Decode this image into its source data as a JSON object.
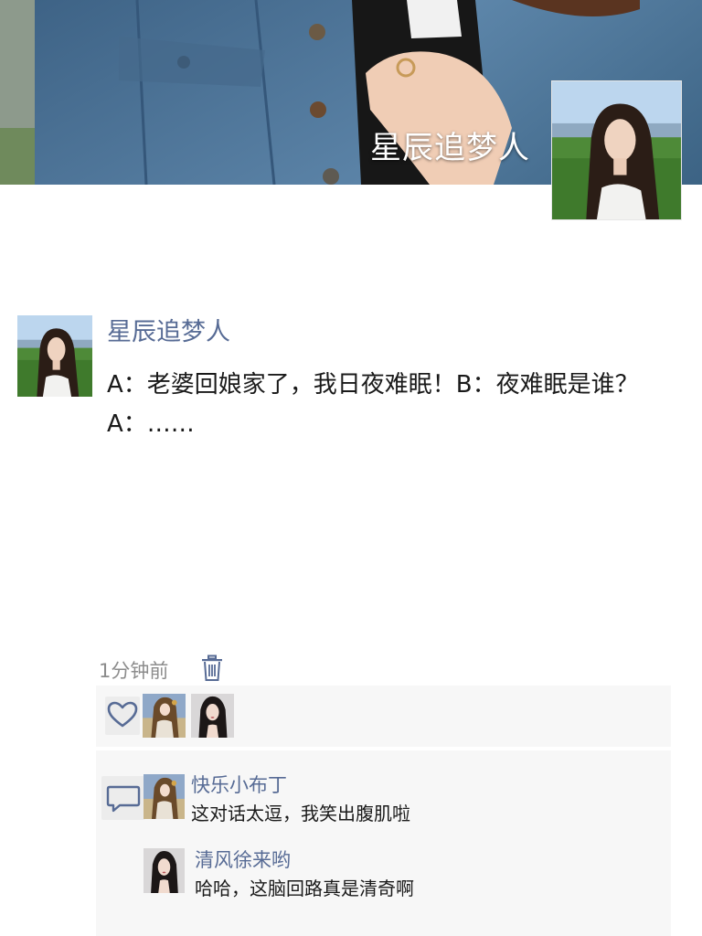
{
  "cover": {
    "username": "星辰追梦人",
    "background_image": "denim-jacket-photo"
  },
  "profile": {
    "avatar": "woman-in-field-portrait"
  },
  "post": {
    "author": "星辰追梦人",
    "avatar": "woman-in-field-portrait",
    "text": "A：老婆回娘家了，我日夜难眠！B：夜难眠是谁？A：……",
    "time": "1分钟前",
    "delete_icon": "trash-icon"
  },
  "likes": {
    "icon": "heart-icon",
    "users": [
      {
        "avatar": "anime-girl-avatar"
      },
      {
        "avatar": "woman-portrait-avatar"
      }
    ]
  },
  "comments": {
    "icon": "comment-bubble-icon",
    "items": [
      {
        "name": "快乐小布丁",
        "text": "这对话太逗，我笑出腹肌啦",
        "avatar": "anime-girl-avatar"
      },
      {
        "name": "清风徐来哟",
        "text": "哈哈，这脑回路真是清奇啊",
        "avatar": "woman-portrait-avatar"
      }
    ]
  },
  "colors": {
    "link": "#576b95",
    "text": "#1a1a1a",
    "muted": "#8c8c8c",
    "panel": "#f7f7f7"
  }
}
